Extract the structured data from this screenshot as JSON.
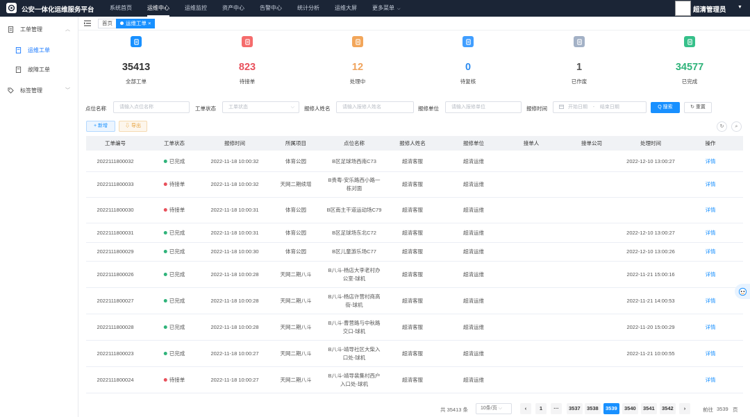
{
  "app": {
    "title": "公安一体化运维服务平台"
  },
  "nav": [
    "系统首页",
    "运维中心",
    "运维监控",
    "资产中心",
    "告警中心",
    "统计分析",
    "运维大屏",
    "更多菜单"
  ],
  "user": {
    "name": "超清管理员"
  },
  "sidebar": {
    "items": [
      {
        "label": "工单管理"
      },
      {
        "label": "运维工单"
      },
      {
        "label": "故障工单"
      },
      {
        "label": "标签管理"
      }
    ]
  },
  "tabs": {
    "home": "首页",
    "current": "运维工单",
    "close": "×"
  },
  "stats": [
    {
      "value": "35413",
      "label": "全部工单",
      "color": "#333333",
      "icon_bg": "#1890ff",
      "icon": "document-icon"
    },
    {
      "value": "823",
      "label": "待接单",
      "color": "#e8505b",
      "icon_bg": "#f56c6c",
      "icon": "clipboard-icon"
    },
    {
      "value": "12",
      "label": "处理中",
      "color": "#f0a35c",
      "icon_bg": "#f2a65a",
      "icon": "clock-icon"
    },
    {
      "value": "0",
      "label": "待复核",
      "color": "#2d8cf0",
      "icon_bg": "#409eff",
      "icon": "review-icon"
    },
    {
      "value": "1",
      "label": "已作废",
      "color": "#555555",
      "icon_bg": "#a3b1c6",
      "icon": "void-icon"
    },
    {
      "value": "34577",
      "label": "已完成",
      "color": "#2fb37a",
      "icon_bg": "#36c08a",
      "icon": "check-icon"
    }
  ],
  "filters": {
    "point_name": {
      "label": "点位名称",
      "placeholder": "请输入点位名称"
    },
    "status": {
      "label": "工单状态",
      "placeholder": "工单状态"
    },
    "reporter": {
      "label": "报修人姓名",
      "placeholder": "请输入报修人姓名"
    },
    "unit": {
      "label": "报修单位",
      "placeholder": "请输入报修单位"
    },
    "time": {
      "label": "报修时间",
      "start": "开始日期",
      "sep": "-",
      "end": "结束日期"
    },
    "search": "Q 搜索",
    "reset": "↻ 重置"
  },
  "toolbar": {
    "add": "+ 新增",
    "export": "⇩ 导出"
  },
  "table": {
    "columns": [
      "工单编号",
      "工单状态",
      "报修时间",
      "所属项目",
      "点位名称",
      "报修人姓名",
      "报修单位",
      "接单人",
      "接单公司",
      "处理时间",
      "操作"
    ],
    "rows": [
      {
        "id": "2022111800032",
        "status": "已完成",
        "status_color": "#2fb37a",
        "time": "2022-11-18 10:00:32",
        "project": "体育公园",
        "point": "B区足球场西南C73",
        "reporter": "超清客服",
        "unit": "超清运维",
        "handler": "",
        "company": "",
        "done": "2022-12-10 13:00:27",
        "op": "详情"
      },
      {
        "id": "2022111800033",
        "status": "待接单",
        "status_color": "#e8505b",
        "time": "2022-11-18 10:00:32",
        "project": "天网二期续增",
        "point": "B贵粤-安乐路西小路一栋对面",
        "reporter": "超清客服",
        "unit": "超清运维",
        "handler": "",
        "company": "",
        "done": "",
        "op": "详情"
      },
      {
        "id": "2022111800030",
        "status": "待接单",
        "status_color": "#e8505b",
        "time": "2022-11-18 10:00:31",
        "project": "体育公园",
        "point": "B区南主干道运动场C79",
        "reporter": "超清客服",
        "unit": "超清运维",
        "handler": "",
        "company": "",
        "done": "",
        "op": "详情"
      },
      {
        "id": "2022111800031",
        "status": "已完成",
        "status_color": "#2fb37a",
        "time": "2022-11-18 10:00:31",
        "project": "体育公园",
        "point": "B区足球场东北C72",
        "reporter": "超清客服",
        "unit": "超清运维",
        "handler": "",
        "company": "",
        "done": "2022-12-10 13:00:27",
        "op": "详情"
      },
      {
        "id": "2022111800029",
        "status": "已完成",
        "status_color": "#2fb37a",
        "time": "2022-11-18 10:00:30",
        "project": "体育公园",
        "point": "B区儿童游乐场C77",
        "reporter": "超清客服",
        "unit": "超清运维",
        "handler": "",
        "company": "",
        "done": "2022-12-10 13:00:26",
        "op": "详情"
      },
      {
        "id": "2022111800026",
        "status": "已完成",
        "status_color": "#2fb37a",
        "time": "2022-11-18 10:00:28",
        "project": "天网二期八斗",
        "point": "B八斗-杨店大李老村办公室-球机",
        "reporter": "超清客服",
        "unit": "超清运维",
        "handler": "",
        "company": "",
        "done": "2022-11-21 15:00:16",
        "op": "详情"
      },
      {
        "id": "2022111800027",
        "status": "已完成",
        "status_color": "#2fb37a",
        "time": "2022-11-18 10:00:28",
        "project": "天网二期八斗",
        "point": "B八斗-杨店许营村商高街-球机",
        "reporter": "超清客服",
        "unit": "超清运维",
        "handler": "",
        "company": "",
        "done": "2022-11-21 14:00:53",
        "op": "详情"
      },
      {
        "id": "2022111800028",
        "status": "已完成",
        "status_color": "#2fb37a",
        "time": "2022-11-18 10:00:28",
        "project": "天网二期八斗",
        "point": "B八斗-曹营路与中秋路交口-球机",
        "reporter": "超清客服",
        "unit": "超清运维",
        "handler": "",
        "company": "",
        "done": "2022-11-20 15:00:29",
        "op": "详情"
      },
      {
        "id": "2022111800023",
        "status": "已完成",
        "status_color": "#2fb37a",
        "time": "2022-11-18 10:00:27",
        "project": "天网二期八斗",
        "point": "B八斗-靖导社区大柴入口处-球机",
        "reporter": "超清客服",
        "unit": "超清运维",
        "handler": "",
        "company": "",
        "done": "2022-11-21 10:00:55",
        "op": "详情"
      },
      {
        "id": "2022111800024",
        "status": "待接单",
        "status_color": "#e8505b",
        "time": "2022-11-18 10:00:27",
        "project": "天网二期八斗",
        "point": "B八斗-靖导裴集村西户入口处-球机",
        "reporter": "超清客服",
        "unit": "超清运维",
        "handler": "",
        "company": "",
        "done": "",
        "op": "详情"
      }
    ]
  },
  "pagination": {
    "total": "共 35413 条",
    "page_size": "10条/页",
    "prev": "‹",
    "next": "›",
    "pages": [
      "1",
      "···",
      "3537",
      "3538",
      "3539",
      "3540",
      "3541",
      "3542"
    ],
    "current": "3539",
    "goto_label": "前往",
    "goto_value": "3539",
    "goto_suffix": "页"
  }
}
